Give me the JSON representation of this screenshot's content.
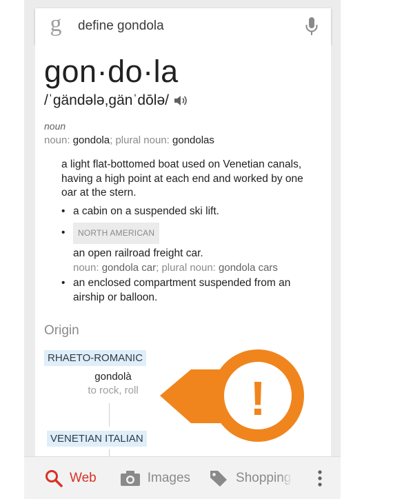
{
  "search": {
    "logo_glyph": "g",
    "query": "define gondola",
    "mic_icon": "microphone-icon"
  },
  "entry": {
    "word": "gon·do·la",
    "phonetic": "/ˈgändələ,gänˈdōlə/",
    "speaker_icon": "speaker-icon",
    "part_of_speech": "noun",
    "forms": {
      "noun_label": "noun: ",
      "noun": "gondola",
      "plural_label": "; plural noun: ",
      "plural": "gondolas"
    },
    "definitions": [
      {
        "text": "a light flat-bottomed boat used on Venetian canals, having a high point at each end and worked by one oar at the stern."
      },
      {
        "text": "a cabin on a suspended ski lift."
      },
      {
        "tag": "NORTH AMERICAN",
        "text": "an open railroad freight car.",
        "note": {
          "noun_label": "noun: ",
          "noun": "gondola car",
          "plural_label": "; plural noun: ",
          "plural": "gondola cars"
        }
      },
      {
        "text": "an enclosed compartment suspended from an airship or balloon."
      }
    ]
  },
  "origin": {
    "title": "Origin",
    "languages": [
      "RHAETO-ROMANIC",
      "VENETIAN ITALIAN"
    ],
    "etymon": "gondolà",
    "gloss": "to rock, roll"
  },
  "warning_overlay": {
    "icon": "exclamation-icon",
    "glyph": "!",
    "color": "#f0851d"
  },
  "bottom_nav": {
    "items": [
      {
        "label": "Web",
        "icon": "search-icon",
        "active": true
      },
      {
        "label": "Images",
        "icon": "camera-icon"
      },
      {
        "label": "Shopping",
        "icon": "tag-icon"
      }
    ],
    "menu_icon": "more-vert-icon"
  },
  "colors": {
    "accent": "#d93025",
    "origin_highlight": "#dfeef9",
    "warning": "#f0851d"
  }
}
